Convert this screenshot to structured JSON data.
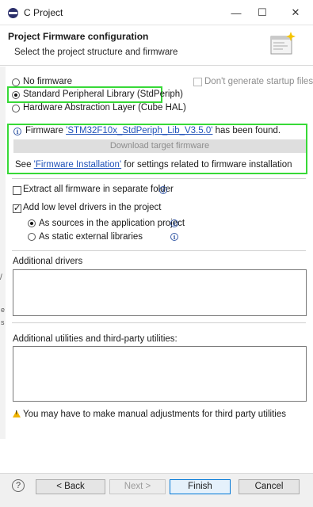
{
  "window": {
    "title": "C Project",
    "minimize": "—",
    "maximize": "☐",
    "close": "✕"
  },
  "header": {
    "title": "Project Firmware configuration",
    "subtitle": "Select the project structure and firmware"
  },
  "firmware_options": {
    "no_firmware": "No firmware",
    "stdperiph": "Standard Peripheral Library (StdPeriph)",
    "hal": "Hardware Abstraction Layer (Cube HAL)",
    "selected": "stdperiph",
    "startup_files_label": "Don't generate startup files"
  },
  "firmware_status": {
    "prefix": "Firmware ",
    "name": "'STM32F10x_StdPeriph_Lib_V3.5.0'",
    "suffix": " has been found.",
    "download_label": "Download target firmware",
    "see_prefix": "See ",
    "see_link": "'Firmware Installation'",
    "see_suffix": " for settings related to firmware installation"
  },
  "options": {
    "extract_label": "Extract all firmware in separate folder",
    "extract_checked": false,
    "low_level_label": "Add low level drivers in the project",
    "low_level_checked": true,
    "as_sources_label": "As sources in the application project",
    "as_static_label": "As static external libraries",
    "driver_mode": "as_sources"
  },
  "additional_drivers_label": "Additional drivers",
  "additional_utilities_label": "Additional utilities and third-party utilities:",
  "warning_text": "You may have to make manual adjustments for third party utilities",
  "buttons": {
    "help": "?",
    "back": "< Back",
    "next": "Next >",
    "finish": "Finish",
    "cancel": "Cancel"
  },
  "colors": {
    "highlight_border": "#37d937",
    "link": "#2052b8",
    "primary_button_border": "#0078d7"
  }
}
